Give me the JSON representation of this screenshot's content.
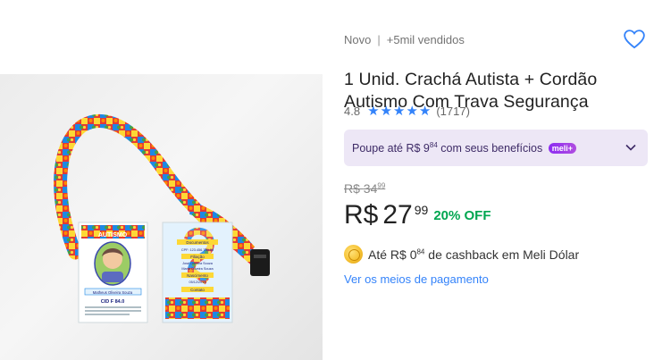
{
  "product": {
    "condition": "Novo",
    "separator": "|",
    "sold": "+5mil vendidos",
    "title": "1 Unid. Crachá Autista + Cordão Autismo Com Trava Segurança",
    "rating": {
      "value": "4.8",
      "stars": 5,
      "count": "(1717)"
    },
    "favorite_icon": "heart-outline-icon"
  },
  "promo": {
    "text_before": "Poupe até R$ 9",
    "text_cents": "84",
    "text_after": " com seus benefícios",
    "badge": "meli+",
    "chevron_icon": "chevron-down-icon"
  },
  "pricing": {
    "old_currency": "R$",
    "old_amount": "34",
    "old_cents": "99",
    "currency": "R$",
    "amount": "27",
    "cents": "99",
    "discount": "20% OFF"
  },
  "cashback": {
    "icon": "coin-icon",
    "before": "Até R$ 0",
    "cents": "84",
    "after": " de cashback em Meli Dólar"
  },
  "payment_link": "Ver os meios de pagamento",
  "badge_card": {
    "header": "AUTISMO",
    "name": "Matheus Oliveira Souza",
    "cid": "CID F 84.0"
  },
  "back_card": {
    "doc": "Documentos",
    "cpf": "CPF: 123.456.789-00",
    "filiacao": "Filiação",
    "parents": [
      "José Oliveira Souza",
      "Maria Oliveira Souza"
    ],
    "nasc": "Nascimento",
    "date": "05/12/2015",
    "contato": "Contato"
  },
  "colors": {
    "accent": "#3483fa",
    "discount": "#00a650",
    "promo_bg": "#ede7f6",
    "meli_badge": "#8c2cf2"
  }
}
